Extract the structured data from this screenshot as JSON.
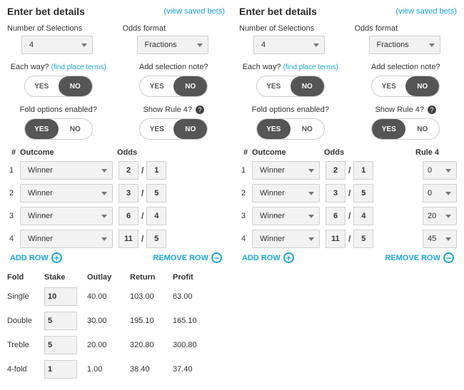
{
  "panels": [
    {
      "id": "left",
      "title": "Enter bet details",
      "viewLink": "(view saved bets)",
      "numSelLabel": "Number of Selections",
      "numSelValue": "4",
      "oddsFmtLabel": "Odds format",
      "oddsFmtValue": "Fractions",
      "eachWayLabel": "Each way?",
      "placeTermsLink": "(find place terms)",
      "addNoteLabel": "Add selection note?",
      "foldLabel": "Fold options enabled?",
      "showRule4Label": "Show Rule 4?",
      "yes": "YES",
      "no": "NO",
      "toggles": {
        "eachWay": "NO",
        "addNote": "NO",
        "fold": "YES",
        "rule4": "NO"
      },
      "tableHead": {
        "num": "#",
        "outcome": "Outcome",
        "odds": "Odds",
        "rule4": ""
      },
      "selections": [
        {
          "n": "1",
          "outcome": "Winner",
          "oddsN": "2",
          "oddsD": "1"
        },
        {
          "n": "2",
          "outcome": "Winner",
          "oddsN": "3",
          "oddsD": "5"
        },
        {
          "n": "3",
          "outcome": "Winner",
          "oddsN": "6",
          "oddsD": "4"
        },
        {
          "n": "4",
          "outcome": "Winner",
          "oddsN": "11",
          "oddsD": "5"
        }
      ],
      "addRow": "ADD ROW",
      "removeRow": "REMOVE ROW",
      "foldTable": {
        "head": {
          "fold": "Fold",
          "stake": "Stake",
          "outlay": "Outlay",
          "return": "Return",
          "profit": "Profit"
        },
        "rows": [
          {
            "fold": "Single",
            "stake": "10",
            "outlay": "40.00",
            "return": "103.00",
            "profit": "63.00"
          },
          {
            "fold": "Double",
            "stake": "5",
            "outlay": "30.00",
            "return": "195.10",
            "profit": "165.10"
          },
          {
            "fold": "Treble",
            "stake": "5",
            "outlay": "20.00",
            "return": "320.80",
            "profit": "300.80"
          },
          {
            "fold": "4-fold",
            "stake": "1",
            "outlay": "1.00",
            "return": "38.40",
            "profit": "37.40"
          }
        ]
      }
    },
    {
      "id": "right",
      "title": "Enter bet details",
      "viewLink": "(view saved bets)",
      "numSelLabel": "Number of Selections",
      "numSelValue": "4",
      "oddsFmtLabel": "Odds format",
      "oddsFmtValue": "Fractions",
      "eachWayLabel": "Each way?",
      "placeTermsLink": "(find place terms)",
      "addNoteLabel": "Add selection note?",
      "foldLabel": "Fold options enabled?",
      "showRule4Label": "Show Rule 4?",
      "yes": "YES",
      "no": "NO",
      "toggles": {
        "eachWay": "NO",
        "addNote": "NO",
        "fold": "YES",
        "rule4": "YES"
      },
      "tableHead": {
        "num": "#",
        "outcome": "Outcome",
        "odds": "Odds",
        "rule4": "Rule 4"
      },
      "selections": [
        {
          "n": "1",
          "outcome": "Winner",
          "oddsN": "2",
          "oddsD": "1",
          "r4": "0"
        },
        {
          "n": "2",
          "outcome": "Winner",
          "oddsN": "3",
          "oddsD": "5",
          "r4": "0"
        },
        {
          "n": "3",
          "outcome": "Winner",
          "oddsN": "6",
          "oddsD": "4",
          "r4": "20"
        },
        {
          "n": "4",
          "outcome": "Winner",
          "oddsN": "11",
          "oddsD": "5",
          "r4": "45"
        }
      ],
      "addRow": "ADD ROW",
      "removeRow": "REMOVE ROW"
    }
  ]
}
